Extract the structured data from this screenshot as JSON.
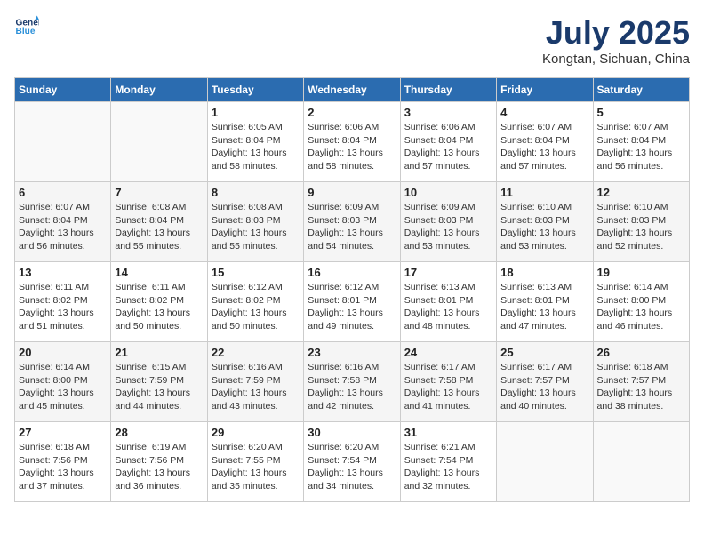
{
  "header": {
    "logo_line1": "General",
    "logo_line2": "Blue",
    "month_title": "July 2025",
    "location": "Kongtan, Sichuan, China"
  },
  "weekdays": [
    "Sunday",
    "Monday",
    "Tuesday",
    "Wednesday",
    "Thursday",
    "Friday",
    "Saturday"
  ],
  "weeks": [
    [
      {
        "day": "",
        "info": ""
      },
      {
        "day": "",
        "info": ""
      },
      {
        "day": "1",
        "sunrise": "6:05 AM",
        "sunset": "8:04 PM",
        "daylight": "13 hours and 58 minutes."
      },
      {
        "day": "2",
        "sunrise": "6:06 AM",
        "sunset": "8:04 PM",
        "daylight": "13 hours and 58 minutes."
      },
      {
        "day": "3",
        "sunrise": "6:06 AM",
        "sunset": "8:04 PM",
        "daylight": "13 hours and 57 minutes."
      },
      {
        "day": "4",
        "sunrise": "6:07 AM",
        "sunset": "8:04 PM",
        "daylight": "13 hours and 57 minutes."
      },
      {
        "day": "5",
        "sunrise": "6:07 AM",
        "sunset": "8:04 PM",
        "daylight": "13 hours and 56 minutes."
      }
    ],
    [
      {
        "day": "6",
        "sunrise": "6:07 AM",
        "sunset": "8:04 PM",
        "daylight": "13 hours and 56 minutes."
      },
      {
        "day": "7",
        "sunrise": "6:08 AM",
        "sunset": "8:04 PM",
        "daylight": "13 hours and 55 minutes."
      },
      {
        "day": "8",
        "sunrise": "6:08 AM",
        "sunset": "8:03 PM",
        "daylight": "13 hours and 55 minutes."
      },
      {
        "day": "9",
        "sunrise": "6:09 AM",
        "sunset": "8:03 PM",
        "daylight": "13 hours and 54 minutes."
      },
      {
        "day": "10",
        "sunrise": "6:09 AM",
        "sunset": "8:03 PM",
        "daylight": "13 hours and 53 minutes."
      },
      {
        "day": "11",
        "sunrise": "6:10 AM",
        "sunset": "8:03 PM",
        "daylight": "13 hours and 53 minutes."
      },
      {
        "day": "12",
        "sunrise": "6:10 AM",
        "sunset": "8:03 PM",
        "daylight": "13 hours and 52 minutes."
      }
    ],
    [
      {
        "day": "13",
        "sunrise": "6:11 AM",
        "sunset": "8:02 PM",
        "daylight": "13 hours and 51 minutes."
      },
      {
        "day": "14",
        "sunrise": "6:11 AM",
        "sunset": "8:02 PM",
        "daylight": "13 hours and 50 minutes."
      },
      {
        "day": "15",
        "sunrise": "6:12 AM",
        "sunset": "8:02 PM",
        "daylight": "13 hours and 50 minutes."
      },
      {
        "day": "16",
        "sunrise": "6:12 AM",
        "sunset": "8:01 PM",
        "daylight": "13 hours and 49 minutes."
      },
      {
        "day": "17",
        "sunrise": "6:13 AM",
        "sunset": "8:01 PM",
        "daylight": "13 hours and 48 minutes."
      },
      {
        "day": "18",
        "sunrise": "6:13 AM",
        "sunset": "8:01 PM",
        "daylight": "13 hours and 47 minutes."
      },
      {
        "day": "19",
        "sunrise": "6:14 AM",
        "sunset": "8:00 PM",
        "daylight": "13 hours and 46 minutes."
      }
    ],
    [
      {
        "day": "20",
        "sunrise": "6:14 AM",
        "sunset": "8:00 PM",
        "daylight": "13 hours and 45 minutes."
      },
      {
        "day": "21",
        "sunrise": "6:15 AM",
        "sunset": "7:59 PM",
        "daylight": "13 hours and 44 minutes."
      },
      {
        "day": "22",
        "sunrise": "6:16 AM",
        "sunset": "7:59 PM",
        "daylight": "13 hours and 43 minutes."
      },
      {
        "day": "23",
        "sunrise": "6:16 AM",
        "sunset": "7:58 PM",
        "daylight": "13 hours and 42 minutes."
      },
      {
        "day": "24",
        "sunrise": "6:17 AM",
        "sunset": "7:58 PM",
        "daylight": "13 hours and 41 minutes."
      },
      {
        "day": "25",
        "sunrise": "6:17 AM",
        "sunset": "7:57 PM",
        "daylight": "13 hours and 40 minutes."
      },
      {
        "day": "26",
        "sunrise": "6:18 AM",
        "sunset": "7:57 PM",
        "daylight": "13 hours and 38 minutes."
      }
    ],
    [
      {
        "day": "27",
        "sunrise": "6:18 AM",
        "sunset": "7:56 PM",
        "daylight": "13 hours and 37 minutes."
      },
      {
        "day": "28",
        "sunrise": "6:19 AM",
        "sunset": "7:56 PM",
        "daylight": "13 hours and 36 minutes."
      },
      {
        "day": "29",
        "sunrise": "6:20 AM",
        "sunset": "7:55 PM",
        "daylight": "13 hours and 35 minutes."
      },
      {
        "day": "30",
        "sunrise": "6:20 AM",
        "sunset": "7:54 PM",
        "daylight": "13 hours and 34 minutes."
      },
      {
        "day": "31",
        "sunrise": "6:21 AM",
        "sunset": "7:54 PM",
        "daylight": "13 hours and 32 minutes."
      },
      {
        "day": "",
        "info": ""
      },
      {
        "day": "",
        "info": ""
      }
    ]
  ]
}
